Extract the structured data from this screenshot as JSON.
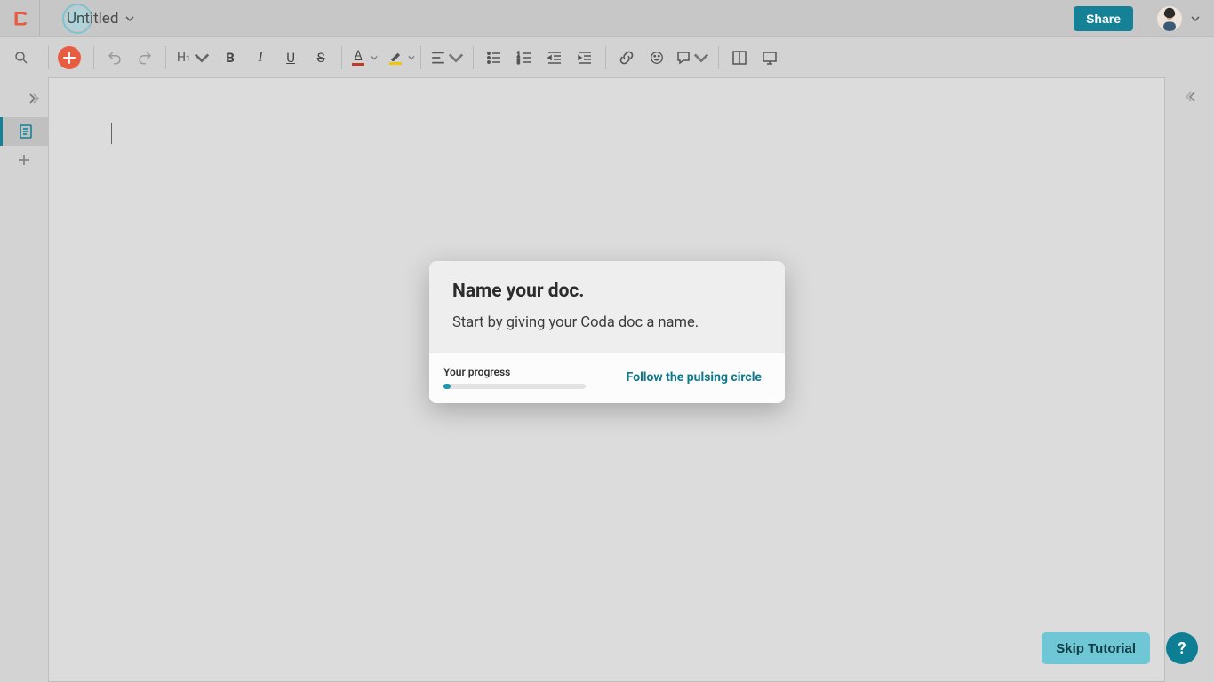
{
  "header": {
    "doc_title": "Untitled",
    "share_label": "Share"
  },
  "tutorial_modal": {
    "title": "Name your doc.",
    "description": "Start by giving your Coda doc a name.",
    "progress_label": "Your progress",
    "progress_percent": 5,
    "follow_label": "Follow the pulsing circle"
  },
  "buttons": {
    "skip_label": "Skip Tutorial",
    "help_label": "?"
  },
  "colors": {
    "accent": "#148196",
    "plus": "#e85c41",
    "text_color_bar": "#c0392b",
    "highlight_color_bar": "#f1c40f"
  }
}
